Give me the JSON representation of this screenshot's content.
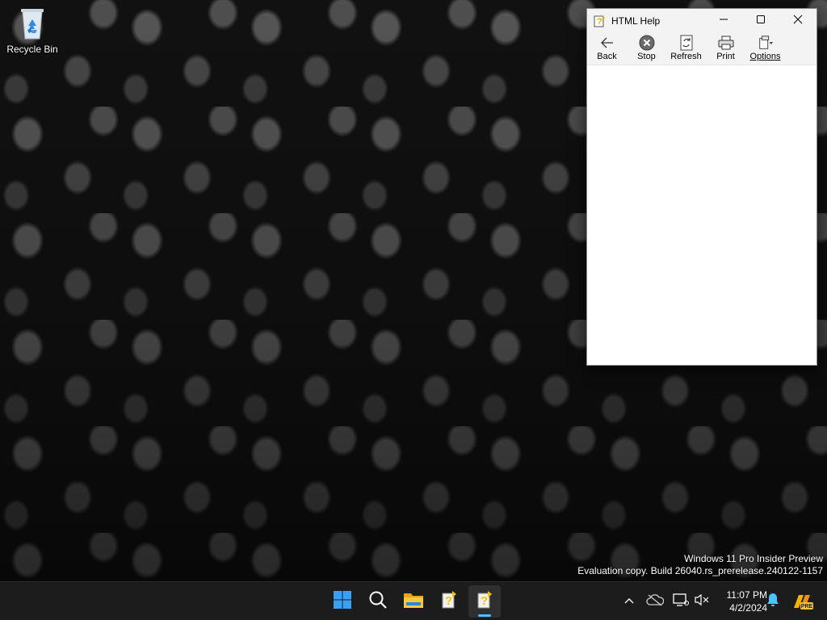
{
  "desktop": {
    "icons": [
      {
        "label": "Recycle Bin",
        "icon": "recycle-bin-icon"
      }
    ]
  },
  "window": {
    "title": "HTML Help",
    "icon": "help-app-icon",
    "caption": {
      "minimize": "minimize-icon",
      "maximize": "maximize-icon",
      "close": "close-icon"
    },
    "toolbar": [
      {
        "label": "Back",
        "icon": "back-arrow-icon"
      },
      {
        "label": "Stop",
        "icon": "stop-icon"
      },
      {
        "label": "Refresh",
        "icon": "refresh-icon"
      },
      {
        "label": "Print",
        "icon": "printer-icon"
      },
      {
        "label": "Options",
        "icon": "options-icon"
      }
    ]
  },
  "watermark": {
    "line1": "Windows 11 Pro Insider Preview",
    "line2": "Evaluation copy. Build 26040.rs_prerelease.240122-1157"
  },
  "taskbar": {
    "apps": [
      {
        "icon": "start-icon"
      },
      {
        "icon": "search-icon"
      },
      {
        "icon": "file-explorer-icon"
      },
      {
        "icon": "help-app-icon"
      },
      {
        "icon": "help-app-icon",
        "active": true
      }
    ],
    "tray": {
      "icons": [
        "chevron-up-icon",
        "onedrive-icon",
        "display-icon",
        "volume-muted-icon"
      ],
      "time": "11:07 PM",
      "date": "4/2/2024",
      "notification_icon": "bell-icon",
      "copilot_badge": "PRE"
    }
  },
  "colors": {
    "accent": "#4cc2ff",
    "taskbar": "#1c1c1c",
    "titlebar": "#f3f3f3"
  }
}
